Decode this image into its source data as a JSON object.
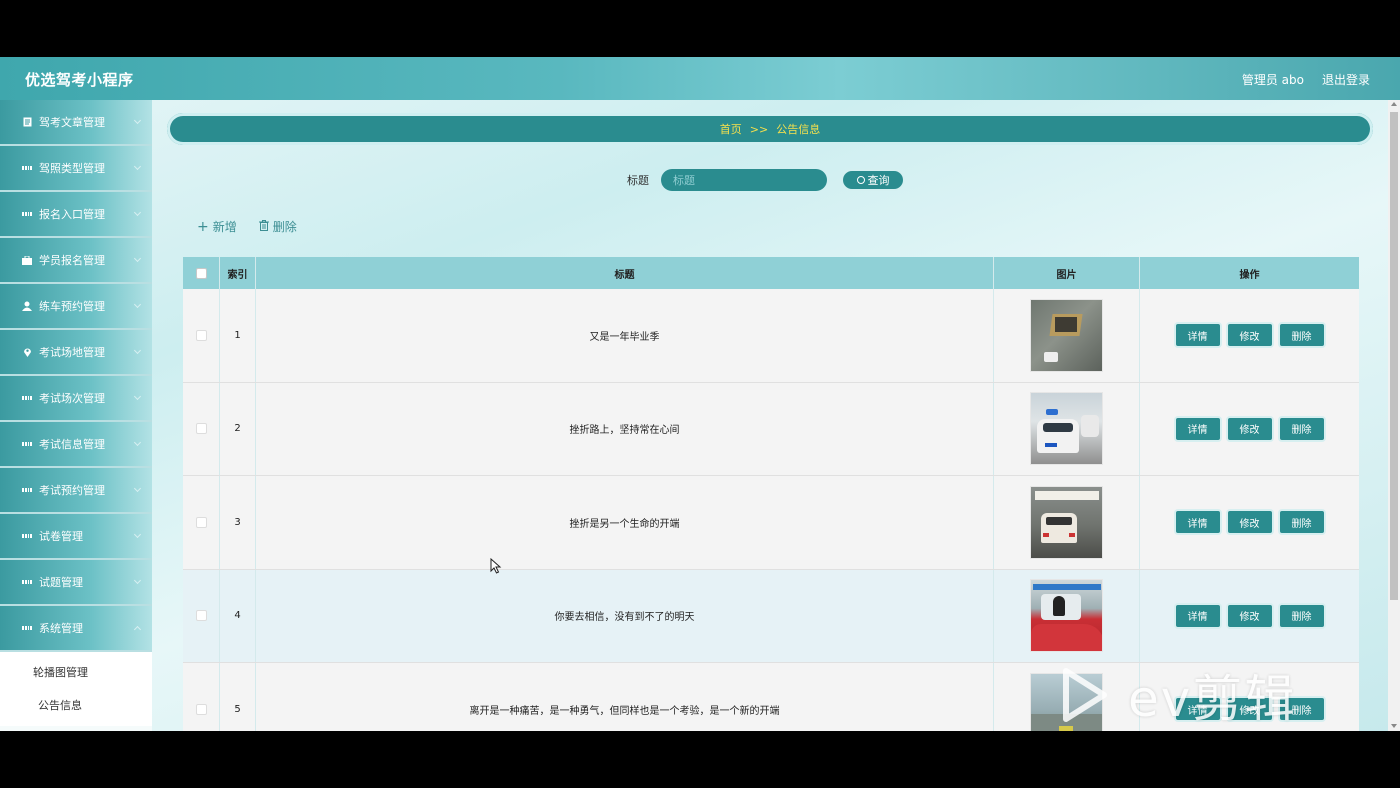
{
  "app": {
    "brand": "优选驾考小程序",
    "user": "管理员 abo",
    "logout": "退出登录"
  },
  "sidebar": {
    "items": [
      {
        "label": "驾考文章管理",
        "icon": "document-icon"
      },
      {
        "label": "驾照类型管理",
        "icon": "grid-icon"
      },
      {
        "label": "报名入口管理",
        "icon": "grid-icon"
      },
      {
        "label": "学员报名管理",
        "icon": "briefcase-icon"
      },
      {
        "label": "练车预约管理",
        "icon": "user-icon"
      },
      {
        "label": "考试场地管理",
        "icon": "location-icon"
      },
      {
        "label": "考试场次管理",
        "icon": "grid-icon"
      },
      {
        "label": "考试信息管理",
        "icon": "grid-icon"
      },
      {
        "label": "考试预约管理",
        "icon": "grid-icon"
      },
      {
        "label": "试卷管理",
        "icon": "grid-icon"
      },
      {
        "label": "试题管理",
        "icon": "grid-icon"
      },
      {
        "label": "系统管理",
        "icon": "grid-icon"
      }
    ],
    "submenu": [
      {
        "label": "轮播图管理"
      },
      {
        "label": "公告信息"
      }
    ]
  },
  "breadcrumb": {
    "home": "首页",
    "separator": ">>",
    "current": "公告信息"
  },
  "search": {
    "label": "标题",
    "placeholder": "标题",
    "button": "查询"
  },
  "actions": {
    "add": "新增",
    "delete": "删除"
  },
  "table": {
    "headers": {
      "index": "索引",
      "title": "标题",
      "image": "图片",
      "ops": "操作"
    },
    "rows": [
      {
        "index": "1",
        "title": "又是一年毕业季",
        "image": "aerial-parking-photo"
      },
      {
        "index": "2",
        "title": "挫折路上，坚持常在心间",
        "image": "white-car-photo"
      },
      {
        "index": "3",
        "title": "挫折是另一个生命的开端",
        "image": "driving-test-photo"
      },
      {
        "index": "4",
        "title": "你要去相信，没有到不了的明天",
        "image": "red-car-photo"
      },
      {
        "index": "5",
        "title": "离开是一种痛苦，是一种勇气，但同样也是一个考验，是一个新的开端",
        "image": "road-photo"
      }
    ],
    "row_buttons": {
      "detail": "详情",
      "edit": "修改",
      "delete": "删除"
    }
  },
  "watermark": {
    "text": "ev剪辑"
  },
  "colors": {
    "accent": "#2a8c8f",
    "breadcrumb_text": "#f4e04d",
    "header": "#8fd0d6"
  }
}
